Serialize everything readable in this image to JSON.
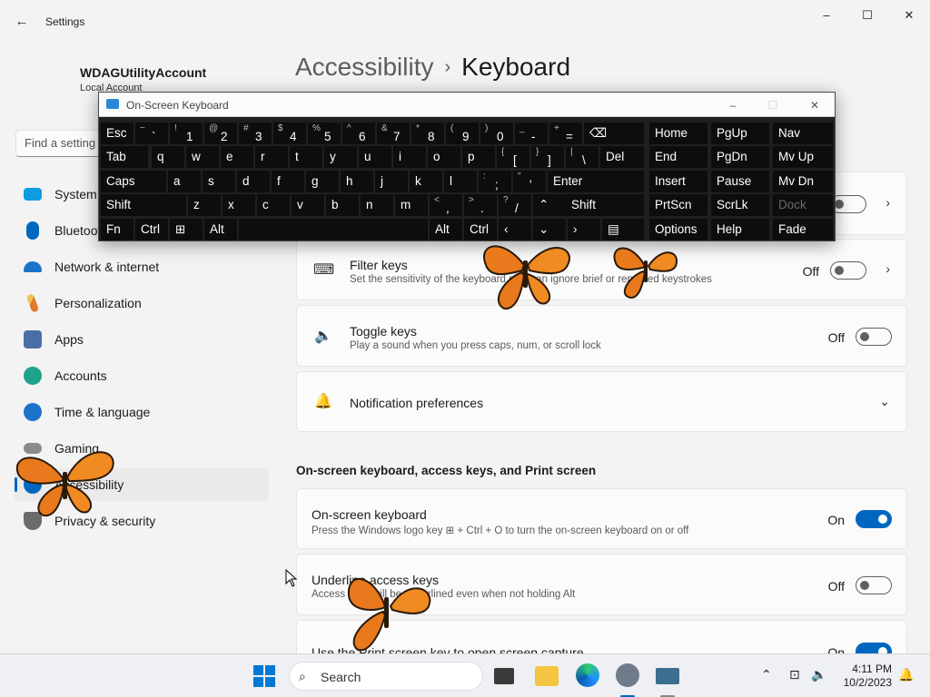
{
  "window": {
    "app_title": "Settings",
    "back_icon": "back-arrow-icon",
    "minimize": "–",
    "maximize": "☐",
    "close": "✕"
  },
  "account": {
    "name": "WDAGUtilityAccount",
    "type": "Local Account"
  },
  "search": {
    "placeholder": "Find a setting"
  },
  "sidebar": {
    "items": [
      {
        "label": "System",
        "icon": "monitor-icon",
        "color": "#0e9be0"
      },
      {
        "label": "Bluetooth & devices",
        "icon": "bluetooth-icon",
        "color": "#0067c0"
      },
      {
        "label": "Network & internet",
        "icon": "wifi-icon",
        "color": "#1a73c9"
      },
      {
        "label": "Personalization",
        "icon": "paintbrush-icon",
        "color": "#e07a2c"
      },
      {
        "label": "Apps",
        "icon": "apps-icon",
        "color": "#4a6fa5"
      },
      {
        "label": "Accounts",
        "icon": "person-icon",
        "color": "#1fa38a"
      },
      {
        "label": "Time & language",
        "icon": "clock-globe-icon",
        "color": "#1a73c9"
      },
      {
        "label": "Gaming",
        "icon": "gamepad-icon",
        "color": "#7a7a7a"
      },
      {
        "label": "Accessibility",
        "icon": "accessibility-icon",
        "color": "#0067c0",
        "active": true
      },
      {
        "label": "Privacy & security",
        "icon": "shield-icon",
        "color": "#6b6b6b"
      }
    ]
  },
  "breadcrumb": {
    "parent": "Accessibility",
    "separator": "›",
    "current": "Keyboard"
  },
  "cards": {
    "filter_keys": {
      "title": "Filter keys",
      "desc": "Set the sensitivity of the keyboard so it can ignore brief or repeated keystrokes",
      "state": "Off"
    },
    "toggle_keys": {
      "title": "Toggle keys",
      "desc": "Play a sound when you press caps, num, or scroll lock",
      "state": "Off"
    },
    "notification_prefs": {
      "title": "Notification preferences"
    },
    "sticky_state": {
      "state": ""
    }
  },
  "section2": {
    "heading": "On-screen keyboard, access keys, and Print screen",
    "osk": {
      "title": "On-screen keyboard",
      "desc": "Press the Windows logo key ⊞ + Ctrl + O to turn the on-screen keyboard on or off",
      "state": "On"
    },
    "underline": {
      "title": "Underline access keys",
      "desc": "Access keys will be underlined even when not holding Alt",
      "state": "Off"
    },
    "printscreen": {
      "title": "Use the Print screen key to open screen capture",
      "state": "On"
    }
  },
  "osk_window": {
    "title": "On-Screen Keyboard",
    "keys": {
      "esc": "Esc",
      "tab": "Tab",
      "caps": "Caps",
      "shift": "Shift",
      "fn": "Fn",
      "ctrl": "Ctrl",
      "alt": "Alt",
      "del": "Del",
      "enter": "Enter",
      "rshift": "Shift",
      "ralt": "Alt",
      "rctrl": "Ctrl",
      "home": "Home",
      "pgup": "PgUp",
      "nav": "Nav",
      "end": "End",
      "pgdn": "PgDn",
      "mvup": "Mv Up",
      "insert": "Insert",
      "pause": "Pause",
      "mvdn": "Mv Dn",
      "prtscn": "PrtScn",
      "scrlk": "ScrLk",
      "dock": "Dock",
      "options": "Options",
      "help": "Help",
      "fade": "Fade"
    },
    "num_row": [
      {
        "sh": "~",
        "mn": "`"
      },
      {
        "sh": "!",
        "mn": "1"
      },
      {
        "sh": "@",
        "mn": "2"
      },
      {
        "sh": "#",
        "mn": "3"
      },
      {
        "sh": "$",
        "mn": "4"
      },
      {
        "sh": "%",
        "mn": "5"
      },
      {
        "sh": "^",
        "mn": "6"
      },
      {
        "sh": "&",
        "mn": "7"
      },
      {
        "sh": "*",
        "mn": "8"
      },
      {
        "sh": "(",
        "mn": "9"
      },
      {
        "sh": ")",
        "mn": "0"
      },
      {
        "sh": "_",
        "mn": "-"
      },
      {
        "sh": "+",
        "mn": "="
      }
    ],
    "row_q": [
      "q",
      "w",
      "e",
      "r",
      "t",
      "y",
      "u",
      "i",
      "o",
      "p"
    ],
    "row_q_sym": [
      {
        "sh": "{",
        "mn": "["
      },
      {
        "sh": "}",
        "mn": "]"
      },
      {
        "sh": "|",
        "mn": "\\"
      }
    ],
    "row_a": [
      "a",
      "s",
      "d",
      "f",
      "g",
      "h",
      "j",
      "k",
      "l"
    ],
    "row_a_sym": [
      {
        "sh": ":",
        "mn": ";"
      },
      {
        "sh": "\"",
        "mn": "'"
      }
    ],
    "row_z": [
      "z",
      "x",
      "c",
      "v",
      "b",
      "n",
      "m"
    ],
    "row_z_sym": [
      {
        "sh": "<",
        "mn": ","
      },
      {
        "sh": ">",
        "mn": "."
      },
      {
        "sh": "?",
        "mn": "/"
      }
    ]
  },
  "taskbar": {
    "search_label": "Search",
    "time": "4:11 PM",
    "date": "10/2/2023"
  }
}
